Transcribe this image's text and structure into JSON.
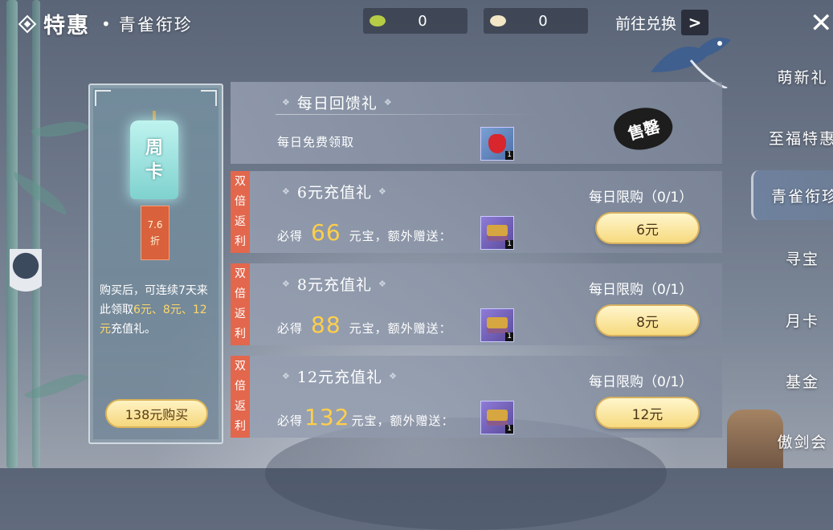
{
  "header": {
    "title": "特惠",
    "dot": "•",
    "subtitle": "青雀衔珍",
    "currencies": [
      {
        "icon": "green-bean-icon",
        "value": "0",
        "color": "#b6cc45"
      },
      {
        "icon": "white-bean-icon",
        "value": "0",
        "color": "#f1e6c5"
      }
    ],
    "exchange_label": "前往兑换",
    "exchange_arrow": ">",
    "close_glyph": "✕"
  },
  "weekly_card": {
    "tag_line1": "周",
    "tag_line2": "卡",
    "discount_value": "7.6",
    "discount_unit": "折",
    "desc_part1": "购买后，可连续7天来此领取",
    "desc_hl1": "6元、8元、12元",
    "desc_part2": "充值礼。",
    "buy_label": "138元购买"
  },
  "offers": [
    {
      "title": "每日回馈礼",
      "reward_text": "每日免费领取",
      "item_icon": "red-pouch-icon",
      "item_qty": "1",
      "status": "售罄",
      "double": false
    },
    {
      "title": "6元充值礼",
      "double": true,
      "double_label": [
        "双",
        "倍",
        "返",
        "利"
      ],
      "reward_prefix": "必得",
      "reward_amount": "66",
      "reward_suffix": "元宝，额外赠送：",
      "item_icon": "gift-box-icon",
      "item_qty": "1",
      "limit": "每日限购（0/1）",
      "price": "6元"
    },
    {
      "title": "8元充值礼",
      "double": true,
      "double_label": [
        "双",
        "倍",
        "返",
        "利"
      ],
      "reward_prefix": "必得",
      "reward_amount": "88",
      "reward_suffix": "元宝，额外赠送：",
      "item_icon": "gift-box-icon",
      "item_qty": "1",
      "limit": "每日限购（0/1）",
      "price": "8元"
    },
    {
      "title": "12元充值礼",
      "double": true,
      "double_label": [
        "双",
        "倍",
        "返",
        "利"
      ],
      "reward_prefix": "必得",
      "reward_amount": "132",
      "reward_suffix": "元宝，额外赠送：",
      "item_icon": "gift-box-icon",
      "item_qty": "1",
      "limit": "每日限购（0/1）",
      "price": "12元"
    }
  ],
  "side_nav": [
    {
      "label": "萌新礼",
      "active": false
    },
    {
      "label": "至福特惠",
      "active": false
    },
    {
      "label": "青雀衔珍",
      "active": true
    },
    {
      "label": "寻宝",
      "active": false
    },
    {
      "label": "月卡",
      "active": false
    },
    {
      "label": "基金",
      "active": false
    },
    {
      "label": "傲剑会",
      "active": false
    }
  ],
  "colors": {
    "accent_gold": "#ffcf4a",
    "double_red": "#e2674d",
    "button_gold": "#f7da7f"
  }
}
